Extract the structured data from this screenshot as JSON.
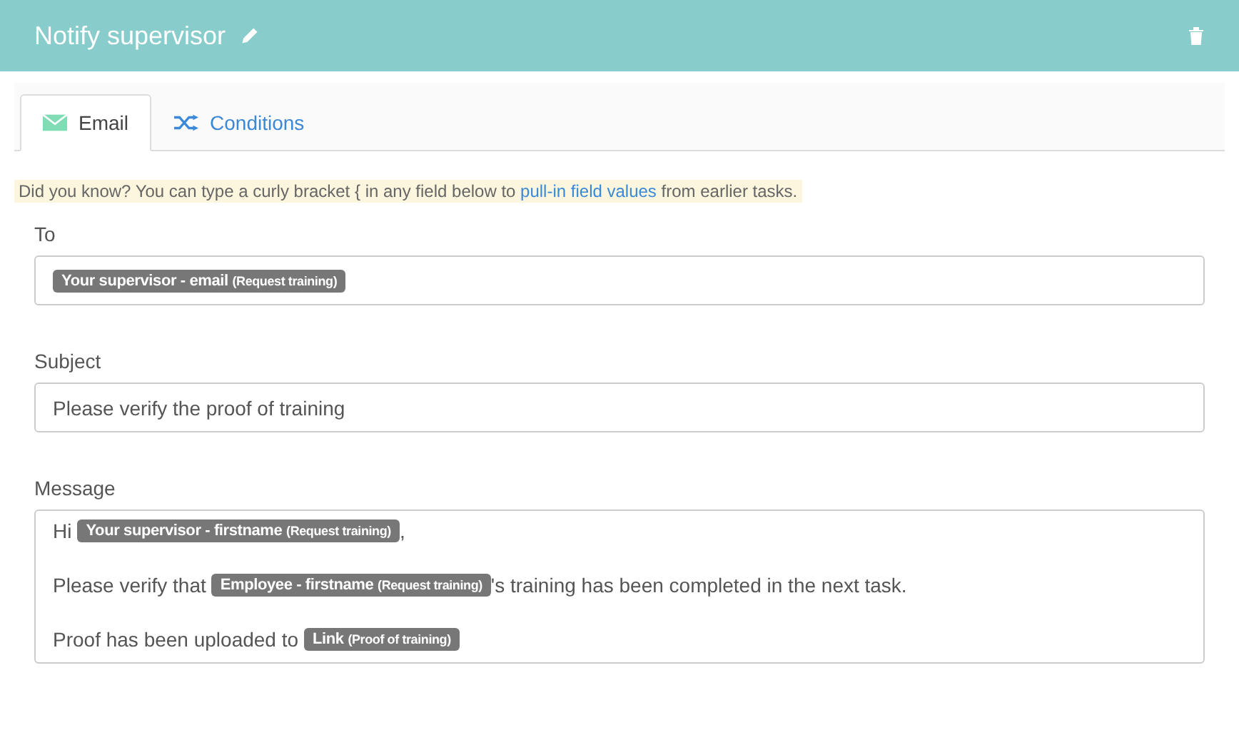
{
  "header": {
    "title": "Notify supervisor"
  },
  "tabs": [
    {
      "label": "Email",
      "selected": true
    },
    {
      "label": "Conditions",
      "selected": false
    }
  ],
  "hint": {
    "before": "Did you know? You can type a curly bracket { in any field below to",
    "link": "pull-in field values",
    "after": "from earlier tasks."
  },
  "to": {
    "label": "To",
    "tokens": [
      {
        "name": "Your supervisor - email",
        "source": "(Request training)"
      }
    ]
  },
  "subject": {
    "label": "Subject",
    "value": "Please verify the proof of training"
  },
  "message": {
    "label": "Message",
    "lines": [
      [
        {
          "kind": "text",
          "text": "Hi"
        },
        {
          "kind": "token",
          "name": "Your supervisor - firstname",
          "source": "(Request training)"
        },
        {
          "kind": "text",
          "text": ","
        }
      ],
      [
        {
          "kind": "text",
          "text": "Please verify that"
        },
        {
          "kind": "token",
          "name": "Employee - firstname",
          "source": "(Request training)"
        },
        {
          "kind": "text",
          "text": "'s training has been completed in the next task."
        }
      ],
      [
        {
          "kind": "text",
          "text": "Proof has been uploaded to"
        },
        {
          "kind": "token",
          "name": "Link",
          "source": "(Proof of training)"
        }
      ]
    ]
  }
}
